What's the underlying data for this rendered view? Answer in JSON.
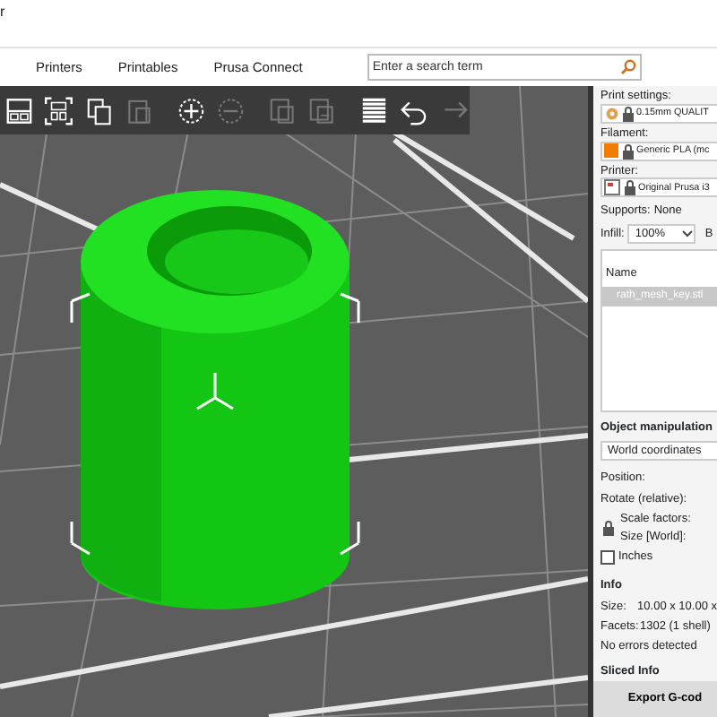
{
  "window": {
    "title": "r"
  },
  "tabs": [
    {
      "label": "Printers"
    },
    {
      "label": "Printables"
    },
    {
      "label": "Prusa Connect"
    }
  ],
  "search": {
    "placeholder": "Enter a search term"
  },
  "toolbar": [
    {
      "kind": "arrange",
      "disabled": false
    },
    {
      "kind": "arrange-selection",
      "disabled": false
    },
    {
      "kind": "copy",
      "disabled": false
    },
    {
      "kind": "paste",
      "disabled": true
    },
    {
      "kind": "add",
      "disabled": false
    },
    {
      "kind": "remove",
      "disabled": true
    },
    {
      "kind": "instance-add",
      "disabled": true
    },
    {
      "kind": "instance-remove",
      "disabled": true
    },
    {
      "kind": "layers",
      "disabled": false
    },
    {
      "kind": "undo",
      "disabled": false
    },
    {
      "kind": "redo",
      "disabled": true
    }
  ],
  "presets": [
    {
      "kind": "print",
      "label": "Print settings:",
      "value": "0.15mm QUALIT"
    },
    {
      "kind": "filament",
      "label": "Filament:",
      "value": "Generic PLA (mc"
    },
    {
      "kind": "printer",
      "label": "Printer:",
      "value": "Original Prusa i3"
    }
  ],
  "supports": {
    "label": "Supports:",
    "value": "None"
  },
  "infill": {
    "label": "Infill:",
    "value": "100%",
    "next": "B"
  },
  "object_list": {
    "header": "Name",
    "items": [
      {
        "name": "rath_mesh_key.stl",
        "selected": true
      }
    ]
  },
  "manipulation": {
    "title": "Object manipulation",
    "coordinates": "World coordinates",
    "position": "Position:",
    "rotate": "Rotate (relative):",
    "scale": "Scale factors:",
    "size": "Size [World]:",
    "inches": {
      "label": "Inches",
      "checked": false
    }
  },
  "info": {
    "title": "Info",
    "rows": [
      {
        "key": "Size:",
        "value": "10.00 x 10.00 x"
      },
      {
        "key": "Facets:",
        "value": "1302 (1 shell)"
      }
    ],
    "status": "No errors detected"
  },
  "sliced_info": {
    "title": "Sliced Info"
  },
  "export_button": "Export G-cod"
}
